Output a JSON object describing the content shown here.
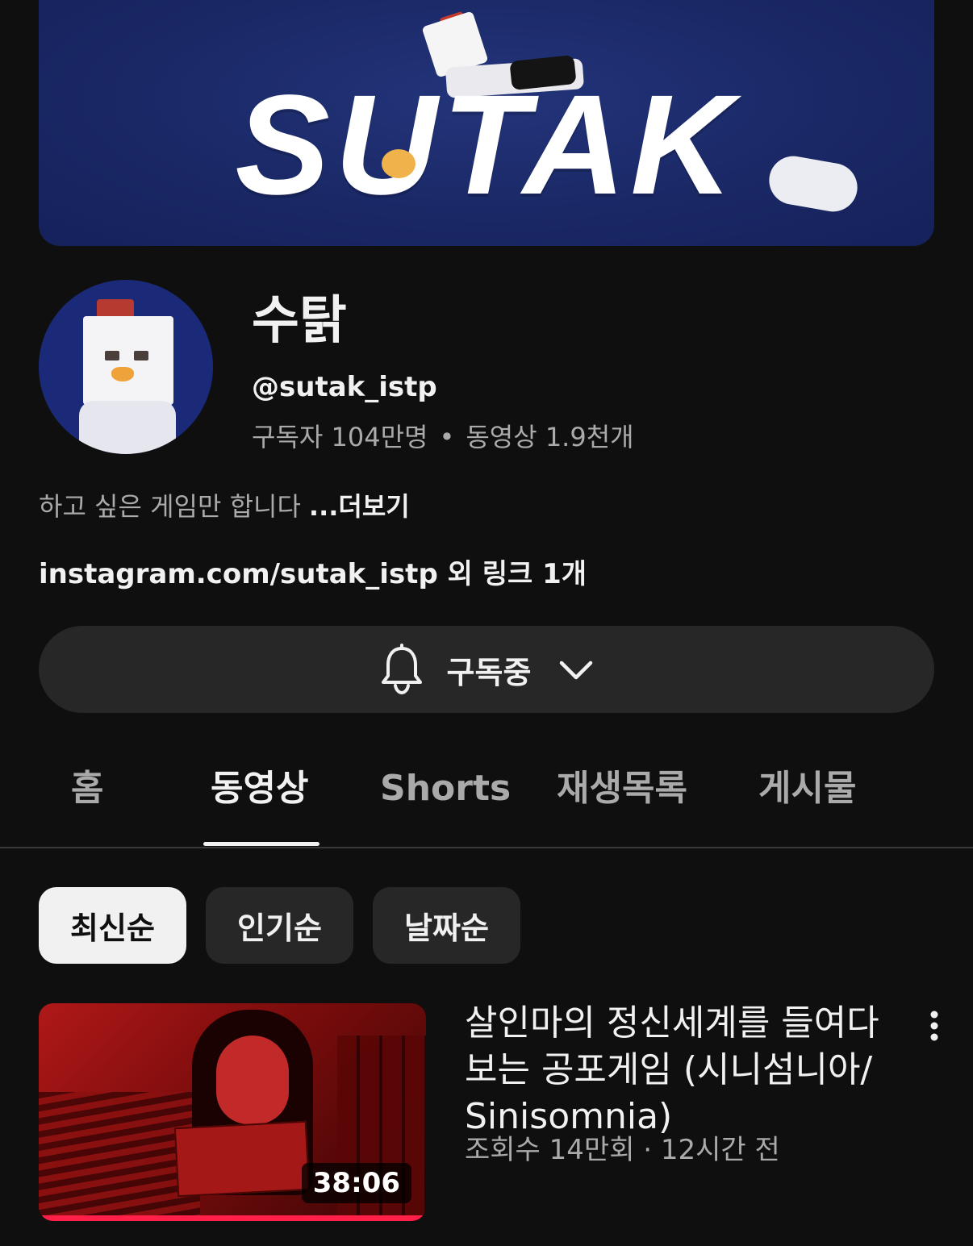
{
  "banner": {
    "logo_text": "SUTAK"
  },
  "channel": {
    "name": "수탉",
    "handle": "@sutak_istp",
    "subscribers": "구독자 104만명",
    "stats_separator": "•",
    "videos": "동영상 1.9천개",
    "description": "하고 싶은 게임만 합니다",
    "more_label": "...더보기",
    "links": "instagram.com/sutak_istp 외 링크 1개"
  },
  "subscribe": {
    "label": "구독중",
    "bell_icon": "bell-icon",
    "chevron_icon": "chevron-down-icon"
  },
  "tabs": [
    {
      "label": "홈",
      "active": false
    },
    {
      "label": "동영상",
      "active": true
    },
    {
      "label": "Shorts",
      "active": false
    },
    {
      "label": "재생목록",
      "active": false
    },
    {
      "label": "게시물",
      "active": false
    }
  ],
  "chips": [
    {
      "label": "최신순",
      "selected": true
    },
    {
      "label": "인기순",
      "selected": false
    },
    {
      "label": "날짜순",
      "selected": false
    }
  ],
  "videos": [
    {
      "title": "살인마의 정신세계를 들여다 보는 공포게임 (시니섬니아/ Sinisomnia)",
      "meta": "조회수 14만회 · 12시간 전",
      "duration": "38:06",
      "watch_progress": 1.0
    }
  ],
  "colors": {
    "background": "#0f0f0f",
    "banner": "#1a2866",
    "progress": "#ff1f48",
    "button": "#272727"
  }
}
